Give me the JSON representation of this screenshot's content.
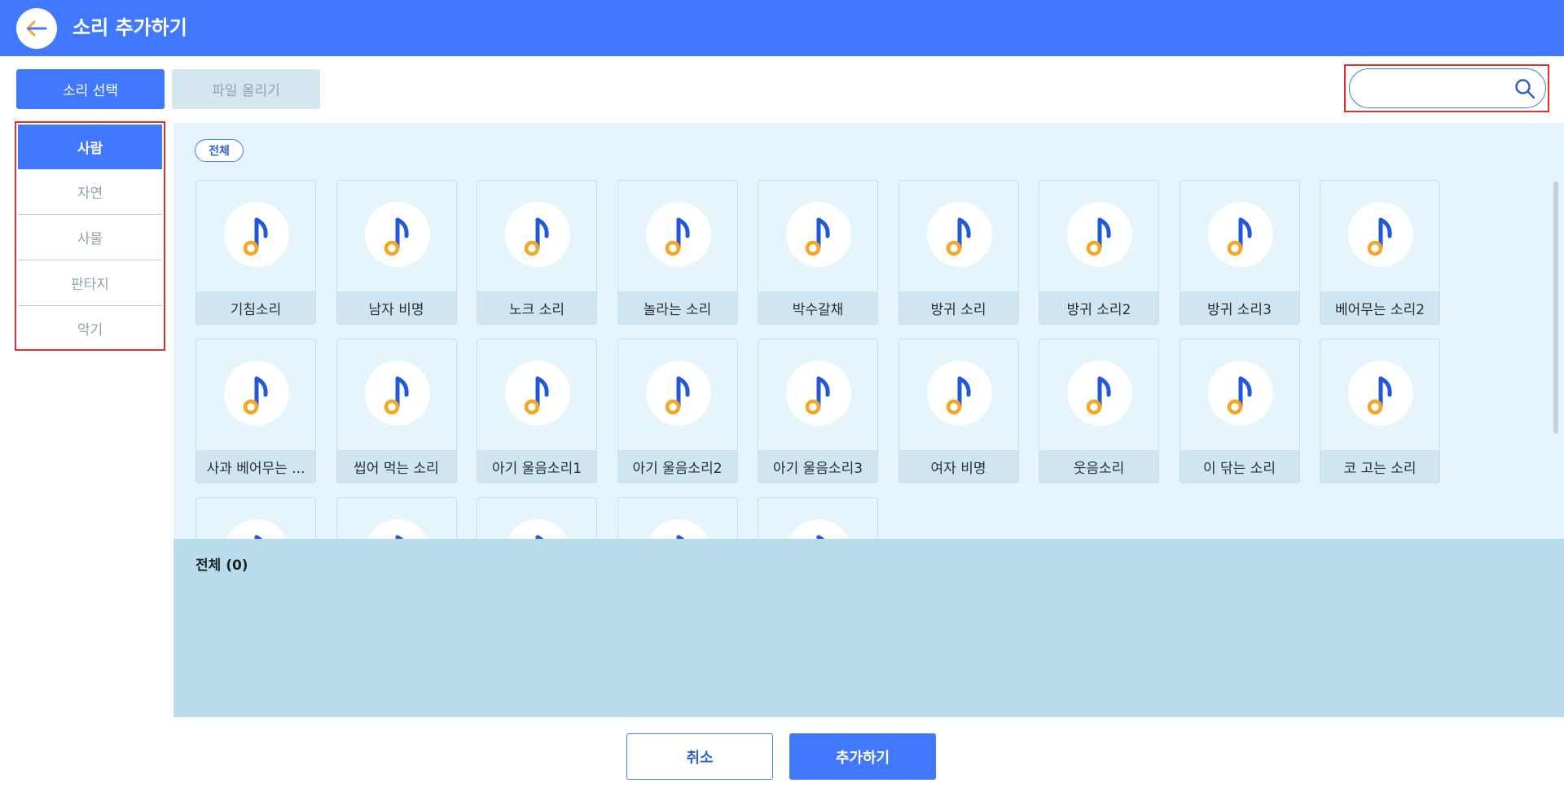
{
  "header": {
    "title": "소리 추가하기",
    "back_icon": "arrow-left-icon"
  },
  "tabs": [
    {
      "label": "소리 선택"
    },
    {
      "label": "파일 올리기"
    }
  ],
  "search": {
    "value": "",
    "placeholder": "",
    "icon": "search-icon"
  },
  "sidebar": {
    "items": [
      {
        "label": "사람"
      },
      {
        "label": "자연"
      },
      {
        "label": "사물"
      },
      {
        "label": "판타지"
      },
      {
        "label": "악기"
      }
    ]
  },
  "filter": {
    "label": "전체"
  },
  "sounds": [
    {
      "name": "기침소리"
    },
    {
      "name": "남자 비명"
    },
    {
      "name": "노크 소리"
    },
    {
      "name": "놀라는 소리"
    },
    {
      "name": "박수갈채"
    },
    {
      "name": "방귀 소리"
    },
    {
      "name": "방귀 소리2"
    },
    {
      "name": "방귀 소리3"
    },
    {
      "name": "베어무는 소리2"
    },
    {
      "name": "사과 베어무는 ..."
    },
    {
      "name": "씹어 먹는 소리"
    },
    {
      "name": "아기 울음소리1"
    },
    {
      "name": "아기 울음소리2"
    },
    {
      "name": "아기 울음소리3"
    },
    {
      "name": "여자 비명"
    },
    {
      "name": "웃음소리"
    },
    {
      "name": "이 닦는 소리"
    },
    {
      "name": "코 고는 소리"
    },
    {
      "name": ""
    },
    {
      "name": ""
    },
    {
      "name": ""
    },
    {
      "name": ""
    },
    {
      "name": ""
    }
  ],
  "selected": {
    "title": "전체 (0)"
  },
  "footer": {
    "cancel_label": "취소",
    "add_label": "추가하기"
  },
  "colors": {
    "primary": "#4079ff",
    "note_orange": "#f5a623",
    "note_blue": "#2358d9"
  }
}
